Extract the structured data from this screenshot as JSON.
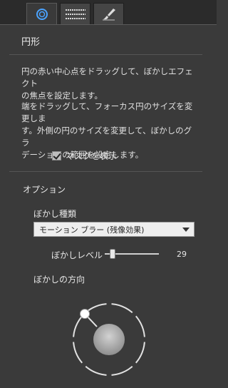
{
  "tabs": [
    {
      "icon": "circle-blur-icon",
      "active": true
    },
    {
      "icon": "lines-icon",
      "active": false
    },
    {
      "icon": "brush-icon",
      "active": false
    }
  ],
  "panel": {
    "title": "円形",
    "desc1_line1": "円の赤い中心点をドラッグして、ぼかしエフェクト",
    "desc1_line2": "の焦点を設定します。",
    "desc2_line1": "端をドラッグして、フォーカス円のサイズを変更しま",
    "desc2_line2": "す。外側の円のサイズを変更して、ぼかしのグラ",
    "desc2_line3": "デーションの範囲を設定します。",
    "show_mask_label": "マスクを表示",
    "show_mask_checked": true
  },
  "options": {
    "title": "オプション",
    "blur_type_label": "ぼかし種類",
    "blur_type_value": "モーション ブラー (残像効果)",
    "blur_level_label": "ぼかしレベル",
    "blur_level_value": "29",
    "blur_level_fraction": 0.14,
    "blur_direction_label": "ぼかしの方向"
  },
  "colors": {
    "background": "#3a3a3a",
    "text": "#e6e6e6"
  }
}
